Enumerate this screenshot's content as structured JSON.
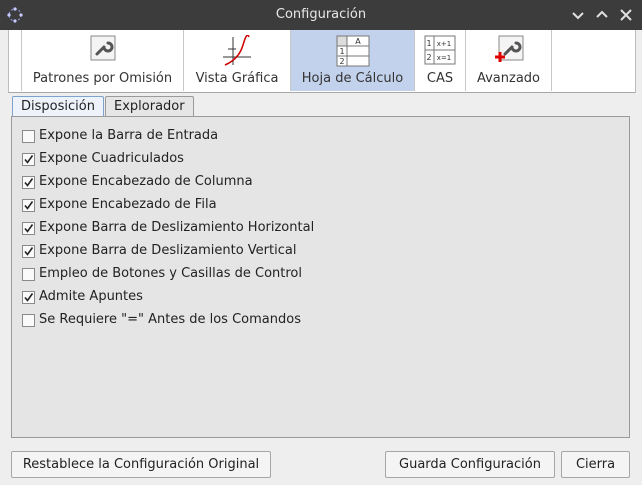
{
  "window": {
    "title": "Configuración"
  },
  "toolbar": {
    "tabs": [
      {
        "label": "Patrones por Omisión",
        "icon": "wrench-icon"
      },
      {
        "label": "Vista Gráfica",
        "icon": "graph-icon"
      },
      {
        "label": "Hoja de Cálculo",
        "icon": "spreadsheet-icon",
        "selected": true
      },
      {
        "label": "CAS",
        "icon": "cas-icon"
      },
      {
        "label": "Avanzado",
        "icon": "advanced-wrench-icon"
      }
    ],
    "spreadsheet_icon": {
      "col": "A",
      "row1": "1",
      "row2": "2"
    },
    "cas_icon": {
      "row1": "1",
      "expr1": "x+1",
      "row2": "2",
      "expr2": "x=1"
    }
  },
  "subtabs": [
    {
      "label": "Disposición",
      "active": true
    },
    {
      "label": "Explorador",
      "active": false
    }
  ],
  "options": [
    {
      "label": "Expone la Barra de Entrada",
      "checked": false
    },
    {
      "label": "Expone Cuadriculados",
      "checked": true
    },
    {
      "label": "Expone Encabezado de Columna",
      "checked": true
    },
    {
      "label": "Expone Encabezado de Fila",
      "checked": true
    },
    {
      "label": "Expone Barra de Deslizamiento Horizontal",
      "checked": true
    },
    {
      "label": "Expone Barra de Deslizamiento Vertical",
      "checked": true
    },
    {
      "label": "Empleo de Botones y Casillas de Control",
      "checked": false
    },
    {
      "label": "Admite Apuntes",
      "checked": true
    },
    {
      "label": "Se Requiere \"=\" Antes de los Comandos",
      "checked": false
    }
  ],
  "buttons": {
    "reset": "Restablece la Configuración Original",
    "save": "Guarda Configuración",
    "close": "Cierra"
  }
}
